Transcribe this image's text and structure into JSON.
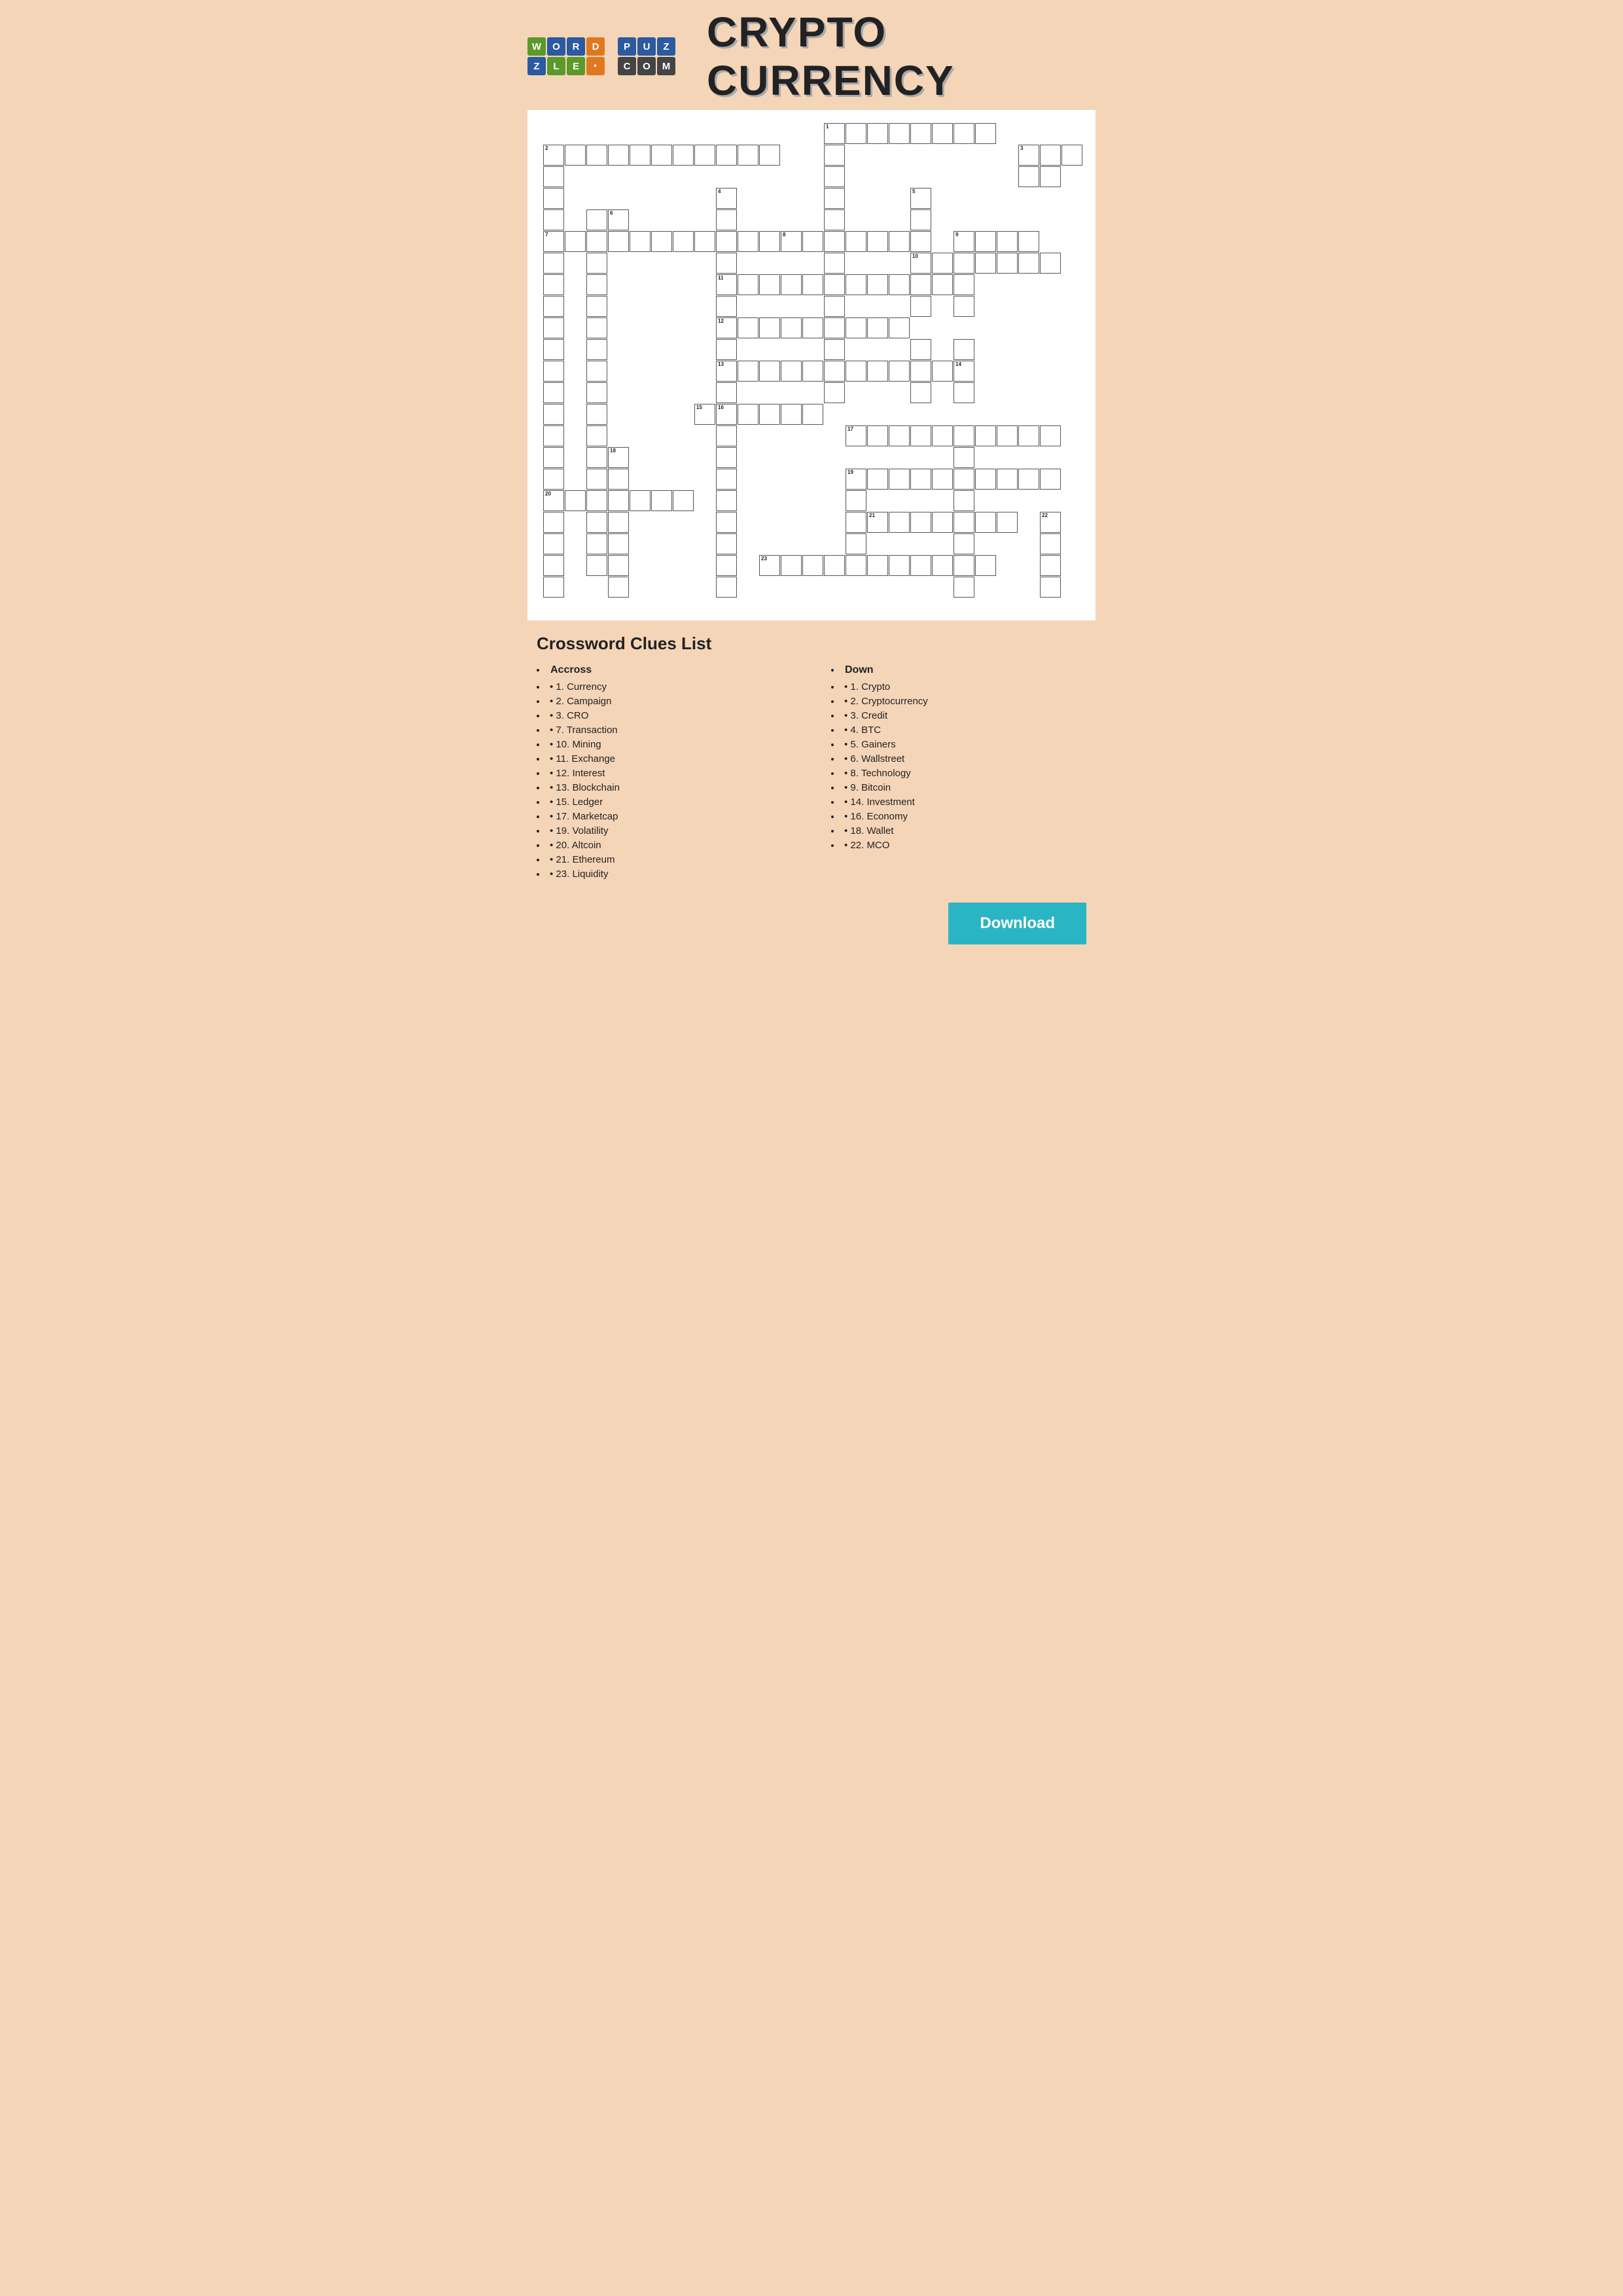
{
  "header": {
    "title": "CRYPTO CURRENCY",
    "logo_letters": [
      {
        "letter": "W",
        "color": "green"
      },
      {
        "letter": "O",
        "color": "blue"
      },
      {
        "letter": "R",
        "color": "blue"
      },
      {
        "letter": "D",
        "color": "orange"
      },
      {
        "letter": "Z",
        "color": "blue"
      },
      {
        "letter": "L",
        "color": "green"
      },
      {
        "letter": "E",
        "color": "green"
      },
      {
        "letter": "·",
        "color": "orange"
      },
      {
        "letter": "P",
        "color": "blue"
      },
      {
        "letter": "U",
        "color": "blue"
      },
      {
        "letter": "Z",
        "color": "blue"
      },
      {
        "letter": "C",
        "color": "dark"
      },
      {
        "letter": "O",
        "color": "dark"
      },
      {
        "letter": "M",
        "color": "dark"
      }
    ]
  },
  "clues": {
    "title": "Crossword Clues List",
    "across_label": "Accross",
    "across": [
      "1. Currency",
      "2. Campaign",
      "3. CRO",
      "7. Transaction",
      "10. Mining",
      "11. Exchange",
      "12. Interest",
      "13. Blockchain",
      "15. Ledger",
      "17. Marketcap",
      "19. Volatility",
      "20. Altcoin",
      "21. Ethereum",
      "23. Liquidity"
    ],
    "down_label": "Down",
    "down": [
      "1. Crypto",
      "2. Cryptocurrency",
      "3. Credit",
      "4. BTC",
      "5. Gainers",
      "6. Wallstreet",
      "8. Technology",
      "9. Bitcoin",
      "14. Investment",
      "16. Economy",
      "18. Wallet",
      "22. MCO"
    ]
  },
  "download_label": "Download"
}
